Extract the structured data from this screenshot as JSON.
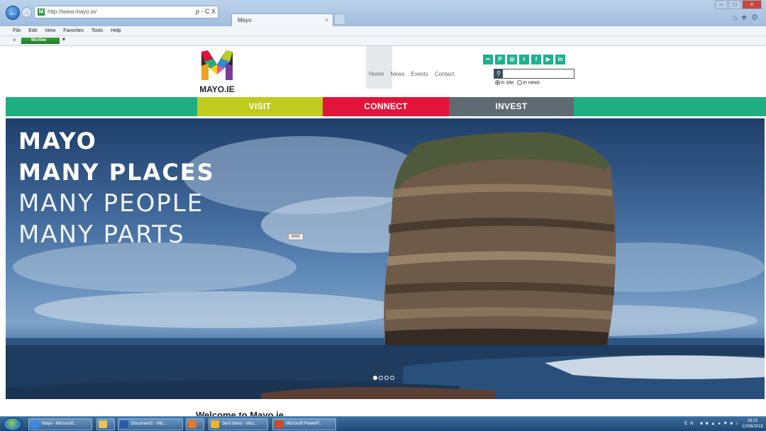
{
  "browser": {
    "url": "http://www.mayo.ie/",
    "address_tools": "ρ - C X",
    "tab_title": "Mayo",
    "menu": [
      "File",
      "Edit",
      "View",
      "Favorites",
      "Tools",
      "Help"
    ],
    "toolbar_addon": "McAfee"
  },
  "site": {
    "logo_text": "MAYO.IE",
    "nav": [
      "Home",
      "News",
      "Events",
      "Contact"
    ],
    "social_icons": [
      "flickr-icon",
      "pinterest-icon",
      "instagram-icon",
      "twitter-icon",
      "facebook-icon",
      "youtube-icon",
      "linkedin-icon"
    ],
    "social_glyphs": [
      "••",
      "P",
      "◎",
      "t",
      "f",
      "▶",
      "in"
    ],
    "search": {
      "placeholder": "",
      "value": ""
    },
    "search_scope": {
      "in_site": "in site",
      "in_news": "in news",
      "selected": "in site"
    },
    "main_nav": {
      "visit": "VISIT",
      "connect": "CONNECT",
      "invest": "INVEST"
    },
    "colors": {
      "green": "#1fae7f",
      "visit": "#bfcc1f",
      "connect": "#e3143a",
      "invest": "#5f6a72"
    }
  },
  "hero": {
    "line1": "MAYO",
    "line2": "MANY PLACES",
    "line3": "MANY PEOPLE",
    "line4": "MANY PARTS",
    "tag": "VISIT",
    "slides": 4,
    "active_slide": 1
  },
  "welcome": "Welcome to Mayo.ie",
  "taskbar": {
    "items": [
      "Mayo - Microsoft...",
      "",
      "Document1 - Mic...",
      "",
      "Sent Items - Micr...",
      "Microsoft PowerP..."
    ],
    "lang": "EN",
    "time": "16:21",
    "date": "12/06/2015"
  }
}
